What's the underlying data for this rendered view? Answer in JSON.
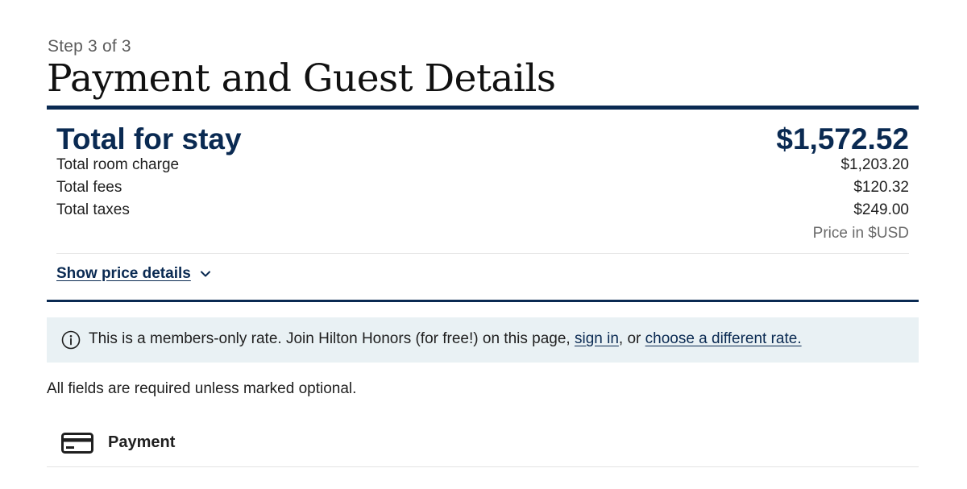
{
  "header": {
    "step": "Step 3 of 3",
    "title": "Payment and Guest Details"
  },
  "summary": {
    "total_label": "Total for stay",
    "total_amount": "$1,572.52",
    "lines": [
      {
        "label": "Total room charge",
        "amount": "$1,203.20"
      },
      {
        "label": "Total fees",
        "amount": "$120.32"
      },
      {
        "label": "Total taxes",
        "amount": "$249.00"
      }
    ],
    "currency_note": "Price in $USD",
    "details_toggle": "Show price details"
  },
  "notice": {
    "icon": "info-icon",
    "text_before": "This is a members-only rate. Join Hilton Honors (for free!) on this page, ",
    "sign_in_link": "sign in",
    "text_middle": ", or ",
    "different_rate_link": "choose a different rate."
  },
  "form": {
    "required_note": "All fields are required unless marked optional.",
    "payment_label": "Payment",
    "payment_icon": "credit-card-icon"
  },
  "colors": {
    "brand_navy": "#0a2a52",
    "notice_bg": "#e9f1f4"
  }
}
